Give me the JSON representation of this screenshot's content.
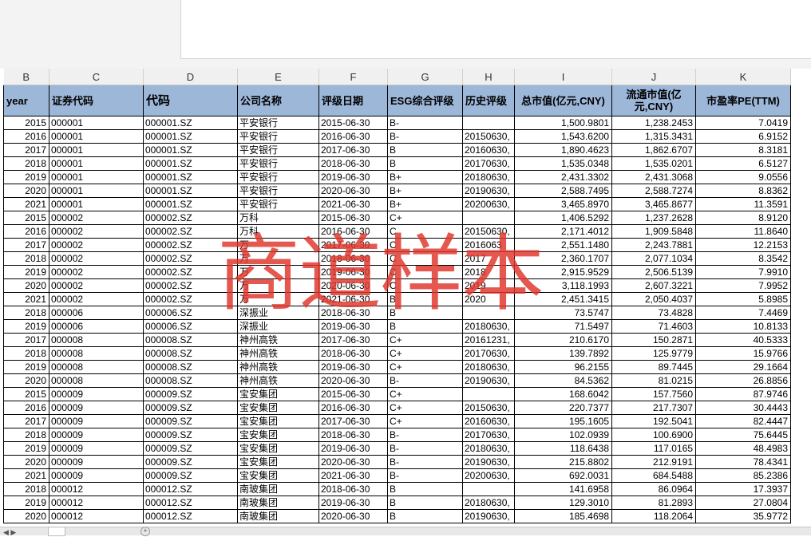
{
  "column_letters": [
    "B",
    "C",
    "D",
    "E",
    "F",
    "G",
    "H",
    "I",
    "J",
    "K"
  ],
  "headers": [
    "year",
    "证券代码",
    "代码",
    "公司名称",
    "评级日期",
    "ESG综合评级",
    "历史评级",
    "总市值(亿元,CNY)",
    "流通市值(亿元,CNY)",
    "市盈率PE(TTM)"
  ],
  "rows": [
    [
      "2015",
      "000001",
      "000001.SZ",
      "平安银行",
      "2015-06-30",
      "B-",
      "",
      "1,500.9801",
      "1,238.2453",
      "7.0419"
    ],
    [
      "2016",
      "000001",
      "000001.SZ",
      "平安银行",
      "2016-06-30",
      "B-",
      "20150630,",
      "1,543.6200",
      "1,315.3431",
      "6.9152"
    ],
    [
      "2017",
      "000001",
      "000001.SZ",
      "平安银行",
      "2017-06-30",
      "B",
      "20160630,",
      "1,890.4623",
      "1,862.6707",
      "8.3181"
    ],
    [
      "2018",
      "000001",
      "000001.SZ",
      "平安银行",
      "2018-06-30",
      "B",
      "20170630,",
      "1,535.0348",
      "1,535.0201",
      "6.5127"
    ],
    [
      "2019",
      "000001",
      "000001.SZ",
      "平安银行",
      "2019-06-30",
      "B+",
      "20180630,",
      "2,431.3302",
      "2,431.3068",
      "9.0556"
    ],
    [
      "2020",
      "000001",
      "000001.SZ",
      "平安银行",
      "2020-06-30",
      "B+",
      "20190630,",
      "2,588.7495",
      "2,588.7274",
      "8.8362"
    ],
    [
      "2021",
      "000001",
      "000001.SZ",
      "平安银行",
      "2021-06-30",
      "B+",
      "20200630,",
      "3,465.8970",
      "3,465.8677",
      "11.3591"
    ],
    [
      "2015",
      "000002",
      "000002.SZ",
      "万科",
      "2015-06-30",
      "C+",
      "",
      "1,406.5292",
      "1,237.2628",
      "8.9120"
    ],
    [
      "2016",
      "000002",
      "000002.SZ",
      "万科",
      "2016-06-30",
      "C",
      "20150630,",
      "2,171.4012",
      "1,909.5848",
      "11.8640"
    ],
    [
      "2017",
      "000002",
      "000002.SZ",
      "万",
      "2017-06-30",
      "C",
      "2016063",
      "2,551.1480",
      "2,243.7881",
      "12.2153"
    ],
    [
      "2018",
      "000002",
      "000002.SZ",
      "万",
      "2018-06-30",
      "C",
      "2017",
      "2,360.1707",
      "2,077.1034",
      "8.3542"
    ],
    [
      "2019",
      "000002",
      "000002.SZ",
      "万",
      "2019-06-30",
      "C",
      "2018",
      "2,915.9529",
      "2,506.5139",
      "7.9910"
    ],
    [
      "2020",
      "000002",
      "000002.SZ",
      "万",
      "2020-06-30",
      "C",
      "2019",
      "3,118.1993",
      "2,607.3221",
      "7.9952"
    ],
    [
      "2021",
      "000002",
      "000002.SZ",
      "万",
      "2021-06-30",
      "B",
      "2020",
      "2,451.3415",
      "2,050.4037",
      "5.8985"
    ],
    [
      "2018",
      "000006",
      "000006.SZ",
      "深振业",
      "2018-06-30",
      "B",
      "",
      "73.5747",
      "73.4828",
      "7.4469"
    ],
    [
      "2019",
      "000006",
      "000006.SZ",
      "深振业",
      "2019-06-30",
      "B",
      "20180630,",
      "71.5497",
      "71.4603",
      "10.8133"
    ],
    [
      "2017",
      "000008",
      "000008.SZ",
      "神州高铁",
      "2017-06-30",
      "C+",
      "20161231,",
      "210.6170",
      "150.2871",
      "40.5333"
    ],
    [
      "2018",
      "000008",
      "000008.SZ",
      "神州高铁",
      "2018-06-30",
      "C+",
      "20170630,",
      "139.7892",
      "125.9779",
      "15.9766"
    ],
    [
      "2019",
      "000008",
      "000008.SZ",
      "神州高铁",
      "2019-06-30",
      "C+",
      "20180630,",
      "96.2155",
      "89.7445",
      "29.1664"
    ],
    [
      "2020",
      "000008",
      "000008.SZ",
      "神州高铁",
      "2020-06-30",
      "B-",
      "20190630,",
      "84.5362",
      "81.0215",
      "26.8856"
    ],
    [
      "2015",
      "000009",
      "000009.SZ",
      "宝安集团",
      "2015-06-30",
      "C+",
      "",
      "168.6042",
      "157.7560",
      "87.9746"
    ],
    [
      "2016",
      "000009",
      "000009.SZ",
      "宝安集团",
      "2016-06-30",
      "C+",
      "20150630,",
      "220.7377",
      "217.7307",
      "30.4443"
    ],
    [
      "2017",
      "000009",
      "000009.SZ",
      "宝安集团",
      "2017-06-30",
      "C+",
      "20160630,",
      "195.1605",
      "192.5041",
      "82.4447"
    ],
    [
      "2018",
      "000009",
      "000009.SZ",
      "宝安集团",
      "2018-06-30",
      "B-",
      "20170630,",
      "102.0939",
      "100.6900",
      "75.6445"
    ],
    [
      "2019",
      "000009",
      "000009.SZ",
      "宝安集团",
      "2019-06-30",
      "B-",
      "20180630,",
      "118.6438",
      "117.0165",
      "48.4983"
    ],
    [
      "2020",
      "000009",
      "000009.SZ",
      "宝安集团",
      "2020-06-30",
      "B-",
      "20190630,",
      "215.8802",
      "212.9191",
      "78.4341"
    ],
    [
      "2021",
      "000009",
      "000009.SZ",
      "宝安集团",
      "2021-06-30",
      "B-",
      "20200630,",
      "692.0031",
      "684.5488",
      "85.2386"
    ],
    [
      "2018",
      "000012",
      "000012.SZ",
      "南玻集团",
      "2018-06-30",
      "B",
      "",
      "141.6958",
      "86.0964",
      "17.3937"
    ],
    [
      "2019",
      "000012",
      "000012.SZ",
      "南玻集团",
      "2019-06-30",
      "B",
      "20180630,",
      "129.3010",
      "81.2893",
      "27.0804"
    ],
    [
      "2020",
      "000012",
      "000012.SZ",
      "南玻集团",
      "2020-06-30",
      "B",
      "20190630,",
      "185.4698",
      "118.2064",
      "35.9772"
    ]
  ],
  "watermark": "商道样本"
}
